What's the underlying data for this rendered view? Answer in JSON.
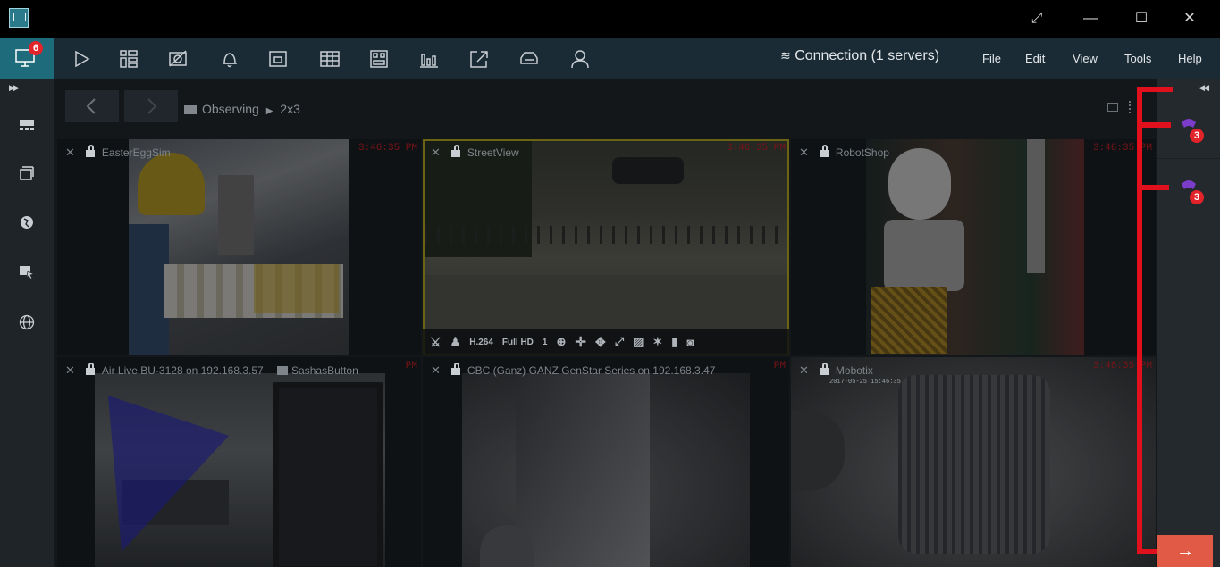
{
  "window": {
    "controls": [
      "restore-icon",
      "minimize-icon",
      "maximize-icon",
      "close-icon"
    ]
  },
  "toolbar": {
    "monitor_badge": "6",
    "tools": [
      "play-icon",
      "layout-icon",
      "camera-off-icon",
      "bell-icon",
      "archive-icon",
      "grid-icon",
      "multiview-icon",
      "chart-icon",
      "export-icon",
      "vehicle-icon",
      "face-icon"
    ],
    "connection_label": "Connection (1 servers)",
    "menu": [
      "File",
      "Edit",
      "View",
      "Tools",
      "Help"
    ]
  },
  "left_sidebar": {
    "items": [
      "layouts-icon",
      "cameras-icon",
      "map-icon",
      "events-icon",
      "web-icon"
    ]
  },
  "view": {
    "breadcrumb_section": "Observing",
    "breadcrumb_sep": "▶",
    "breadcrumb_layout": "2x3",
    "tiles": [
      {
        "name": "EasterEggSim",
        "timestamp": "3:46:35 PM"
      },
      {
        "name": "StreetView",
        "timestamp": "3:46:35 PM"
      },
      {
        "name": "RobotShop",
        "timestamp": "3:46:35 PM"
      },
      {
        "name": "Air Live BU-3128 on 192.168.3.57",
        "button_label": "SashasButton",
        "timestamp": "PM"
      },
      {
        "name": "CBC (Ganz) GANZ GenStar Series on 192.168.3.47",
        "timestamp": "PM"
      },
      {
        "name": "Mobotix",
        "timestamp": "3:46:35 PM",
        "overlay_text": "2017-05-25 15:46:35"
      }
    ],
    "ptz_bar": {
      "codec": "H.264",
      "resolution": "Full HD",
      "speed": "1"
    }
  },
  "right_panel": {
    "alarms": [
      {
        "count": "3"
      },
      {
        "count": "3"
      }
    ]
  },
  "colors": {
    "accent": "#1e6b7c",
    "alert": "#e2232a",
    "annotation": "#e0101c",
    "arrow_button": "#e05a46"
  }
}
